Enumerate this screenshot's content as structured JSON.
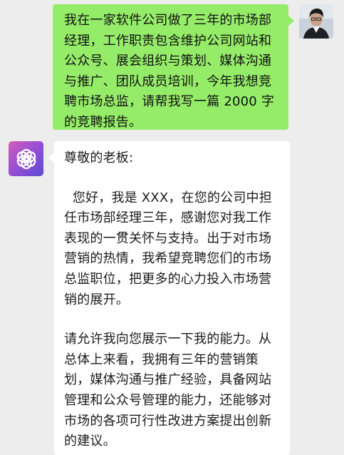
{
  "user_message": {
    "text": "我在一家软件公司做了三年的市场部经理，工作职责包含维护公司网站和公众号、展会组织与策划、媒体沟通与推广、团队成员培训，今年我想竞聘市场总监，请帮我写一篇 2000 字的竞聘报告。"
  },
  "assistant_message": {
    "greeting": "尊敬的老板:",
    "paragraphs": [
      "  您好，我是 XXX，在您的公司中担任市场部经理三年，感谢您对我工作表现的一贯关怀与支持。出于对市场营销的热情，我希望竞聘您们的市场总监职位，把更多的心力投入市场营销的展开。",
      "请允许我向您展示一下我的能力。从总体上来看，我拥有三年的营销策划，媒体沟通与推广经验，具备网站管理和公众号管理的能力，还能够对市场的各项可行性改进方案提出创新的建议。"
    ]
  },
  "colors": {
    "background": "#ededed",
    "user_bubble": "#95ec69",
    "assistant_bubble": "#ffffff",
    "assistant_avatar_gradient": [
      "#d35fb9",
      "#9a4fd3",
      "#5b4bd6"
    ]
  },
  "icons": {
    "user_avatar": "user-photo-avatar",
    "assistant_avatar": "chatgpt-logo-icon"
  }
}
